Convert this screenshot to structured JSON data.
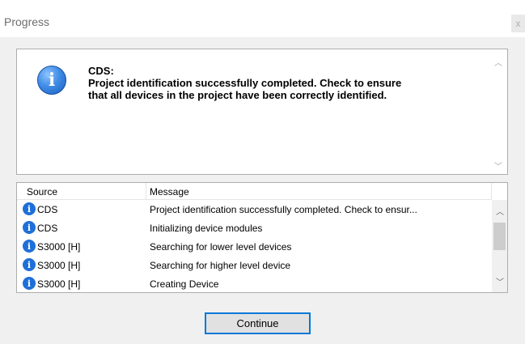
{
  "window": {
    "title": "Progress",
    "close_glyph": "x"
  },
  "message_panel": {
    "icon": "info-icon",
    "heading": "CDS:",
    "lines": [
      "Project identification successfully completed. Check to ensure",
      "that all devices in the project have been correctly identified."
    ]
  },
  "log": {
    "columns": {
      "source": "Source",
      "message": "Message"
    },
    "rows": [
      {
        "icon": "info-icon",
        "source": "CDS",
        "message": "Project identification successfully completed.  Check to ensur..."
      },
      {
        "icon": "info-icon",
        "source": "CDS",
        "message": "Initializing device modules"
      },
      {
        "icon": "info-icon",
        "source": "S3000 [H]",
        "message": "Searching for lower level devices"
      },
      {
        "icon": "info-icon",
        "source": "S3000 [H]",
        "message": "Searching for higher level device"
      },
      {
        "icon": "info-icon",
        "source": "S3000 [H]",
        "message": "Creating Device"
      }
    ]
  },
  "footer": {
    "continue_label": "Continue"
  }
}
